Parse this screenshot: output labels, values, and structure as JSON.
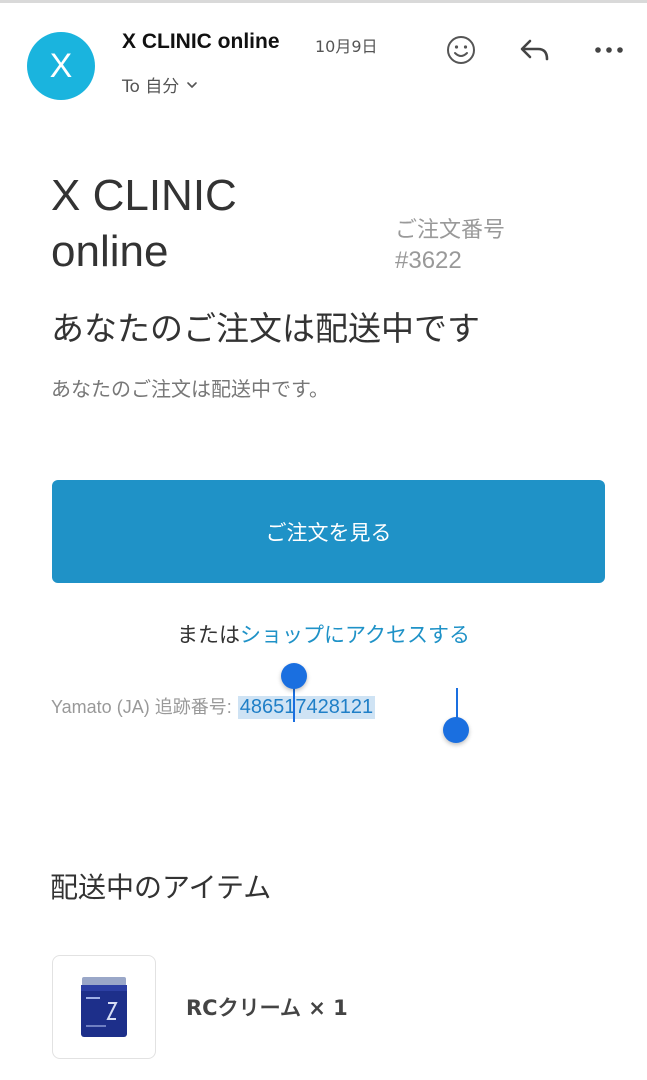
{
  "email": {
    "avatar_letter": "X",
    "sender": "X CLINIC online",
    "date": "10月9日",
    "recipient": "To 自分"
  },
  "icons": {
    "emoji": "smiley-icon",
    "reply": "reply-icon",
    "more": "more-icon",
    "recipient_toggle": "chevron-down-icon"
  },
  "body": {
    "brand_line1": "X CLINIC",
    "brand_line2": "online",
    "order_label": "ご注文番号",
    "order_number": "#3622",
    "heading": "あなたのご注文は配送中です",
    "subtext": "あなたのご注文は配送中です。",
    "cta_label": "ご注文を見る",
    "or_text": "または",
    "shop_link": "ショップにアクセスする",
    "tracking_label": "Yamato (JA) 追跡番号:",
    "tracking_number": "486517428121",
    "section_title": "配送中のアイテム"
  },
  "items": [
    {
      "name": "RCクリーム × 1"
    }
  ],
  "colors": {
    "avatar": "#1ab4de",
    "button": "#1f92c7",
    "link": "#1f92c7",
    "selection_handle": "#1a6fe0",
    "selection_highlight": "#cfe3f4"
  }
}
